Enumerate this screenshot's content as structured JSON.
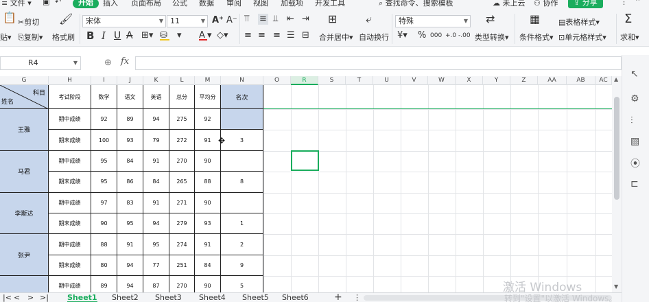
{
  "menu": {
    "file": "文件",
    "start": "开始",
    "insert": "插入",
    "page_layout": "页面布局",
    "formula": "公式",
    "data": "数据",
    "review": "审阅",
    "view": "视图",
    "addons": "加载项",
    "developer": "开发工具",
    "search": "查找命令、搜索模板",
    "cloud": "未上云",
    "collab": "协作",
    "share": "分享"
  },
  "ribbon": {
    "paste": "贴",
    "cut": "剪切",
    "copy": "复制",
    "format_painter": "格式刷",
    "font_name": "宋体",
    "font_size": "11",
    "bold": "B",
    "italic": "I",
    "underline": "U",
    "font_color_a": "A",
    "merge_center": "合并居中",
    "wrap_text": "自动换行",
    "number_format": "特殊",
    "percent": "%",
    "thousands": "000",
    "type_convert": "类型转换",
    "cond_format": "条件格式",
    "table_style": "表格样式",
    "cell_style": "单元格样式",
    "sum": "求和"
  },
  "formula_bar": {
    "name_box": "R4",
    "fx": "fx",
    "content": ""
  },
  "columns": [
    "G",
    "H",
    "I",
    "J",
    "K",
    "L",
    "M",
    "N",
    "O",
    "R",
    "S",
    "T",
    "U",
    "V",
    "W",
    "X",
    "Y",
    "Z",
    "AA",
    "AB",
    "AC"
  ],
  "selected_column": "R",
  "table": {
    "header_subject": "科目",
    "header_name": "姓名",
    "headers": [
      "考试阶段",
      "数学",
      "语文",
      "英语",
      "总分",
      "平均分",
      "名次"
    ],
    "students": [
      {
        "name": "王雅",
        "rows": [
          [
            "期中成绩",
            "92",
            "89",
            "94",
            "275",
            "92",
            ""
          ],
          [
            "期末成绩",
            "100",
            "93",
            "79",
            "272",
            "91",
            "3"
          ]
        ]
      },
      {
        "name": "马君",
        "rows": [
          [
            "期中成绩",
            "95",
            "84",
            "91",
            "270",
            "90",
            ""
          ],
          [
            "期末成绩",
            "95",
            "86",
            "84",
            "265",
            "88",
            "8"
          ]
        ]
      },
      {
        "name": "李斯达",
        "rows": [
          [
            "期中成绩",
            "97",
            "83",
            "91",
            "271",
            "90",
            ""
          ],
          [
            "期末成绩",
            "90",
            "95",
            "94",
            "279",
            "93",
            "1"
          ]
        ]
      },
      {
        "name": "张尹",
        "rows": [
          [
            "期中成绩",
            "88",
            "91",
            "95",
            "274",
            "91",
            "2"
          ],
          [
            "期末成绩",
            "80",
            "94",
            "77",
            "251",
            "84",
            "9"
          ]
        ]
      },
      {
        "name": "",
        "rows": [
          [
            "期中成绩",
            "89",
            "94",
            "87",
            "270",
            "90",
            "5"
          ]
        ]
      }
    ]
  },
  "sheets": [
    "Sheet1",
    "Sheet2",
    "Sheet3",
    "Sheet4",
    "Sheet5",
    "Sheet6"
  ],
  "active_sheet": "Sheet1",
  "watermark": {
    "line1": "激活 Windows",
    "line2": "转到\"设置\"以激活 Windows。"
  },
  "colors": {
    "accent": "#1aad5d",
    "header_fill": "#c7d6ec"
  }
}
